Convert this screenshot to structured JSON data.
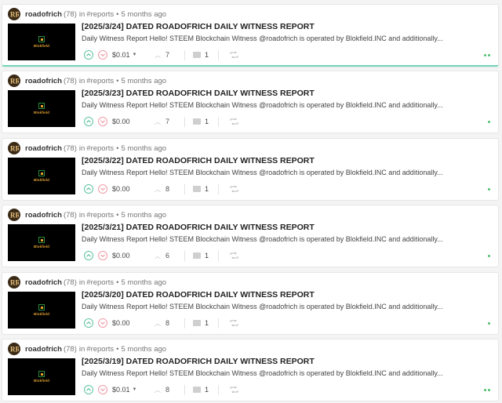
{
  "posts": [
    {
      "author": "roadofrich",
      "reputation": "(78)",
      "in_text": "in",
      "tag": "#reports",
      "bullet": "•",
      "age": "5 months ago",
      "title": "[2025/3/24] DATED ROADOFRICH DAILY WITNESS REPORT",
      "summary": "Daily Witness Report Hello! STEEM Blockchain Witness @roadofrich is operated by Blokfield.INC and additionally...",
      "payout": "$0.01",
      "payout_has_dropdown": true,
      "votes": "7",
      "comments": "1",
      "thumb_text": "Blokfield",
      "status_dots": 2,
      "active": true
    },
    {
      "author": "roadofrich",
      "reputation": "(78)",
      "in_text": "in",
      "tag": "#reports",
      "bullet": "•",
      "age": "5 months ago",
      "title": "[2025/3/23] DATED ROADOFRICH DAILY WITNESS REPORT",
      "summary": "Daily Witness Report Hello! STEEM Blockchain Witness @roadofrich is operated by Blokfield.INC and additionally...",
      "payout": "$0.00",
      "payout_has_dropdown": false,
      "votes": "7",
      "comments": "1",
      "thumb_text": "Blokfield",
      "status_dots": 1,
      "active": false
    },
    {
      "author": "roadofrich",
      "reputation": "(78)",
      "in_text": "in",
      "tag": "#reports",
      "bullet": "•",
      "age": "5 months ago",
      "title": "[2025/3/22] DATED ROADOFRICH DAILY WITNESS REPORT",
      "summary": "Daily Witness Report Hello! STEEM Blockchain Witness @roadofrich is operated by Blokfield.INC and additionally...",
      "payout": "$0.00",
      "payout_has_dropdown": false,
      "votes": "8",
      "comments": "1",
      "thumb_text": "Blokfield",
      "status_dots": 1,
      "active": false
    },
    {
      "author": "roadofrich",
      "reputation": "(78)",
      "in_text": "in",
      "tag": "#reports",
      "bullet": "•",
      "age": "5 months ago",
      "title": "[2025/3/21] DATED ROADOFRICH DAILY WITNESS REPORT",
      "summary": "Daily Witness Report Hello! STEEM Blockchain Witness @roadofrich is operated by Blokfield.INC and additionally...",
      "payout": "$0.00",
      "payout_has_dropdown": false,
      "votes": "6",
      "comments": "1",
      "thumb_text": "Blokfield",
      "status_dots": 1,
      "active": false
    },
    {
      "author": "roadofrich",
      "reputation": "(78)",
      "in_text": "in",
      "tag": "#reports",
      "bullet": "•",
      "age": "5 months ago",
      "title": "[2025/3/20] DATED ROADOFRICH DAILY WITNESS REPORT",
      "summary": "Daily Witness Report Hello! STEEM Blockchain Witness @roadofrich is operated by Blokfield.INC and additionally...",
      "payout": "$0.00",
      "payout_has_dropdown": false,
      "votes": "8",
      "comments": "1",
      "thumb_text": "Blokfield",
      "status_dots": 1,
      "active": false
    },
    {
      "author": "roadofrich",
      "reputation": "(78)",
      "in_text": "in",
      "tag": "#reports",
      "bullet": "•",
      "age": "5 months ago",
      "title": "[2025/3/19] DATED ROADOFRICH DAILY WITNESS REPORT",
      "summary": "Daily Witness Report Hello! STEEM Blockchain Witness @roadofrich is operated by Blokfield.INC and additionally...",
      "payout": "$0.01",
      "payout_has_dropdown": true,
      "votes": "8",
      "comments": "1",
      "thumb_text": "Blokfield",
      "status_dots": 2,
      "active": false
    }
  ],
  "icons": {
    "upvote": "chevron-up-icon",
    "downvote": "chevron-down-icon",
    "comments": "comment-icon",
    "reblog": "reblog-icon",
    "avatar": "roadofrich-avatar"
  },
  "colors": {
    "upvote": "#5fc49f",
    "downvote": "#f29aa6",
    "active_border": "#6fd6b8",
    "status_dot": "#4bbf6b",
    "thumb_accent": "#e0a030"
  }
}
